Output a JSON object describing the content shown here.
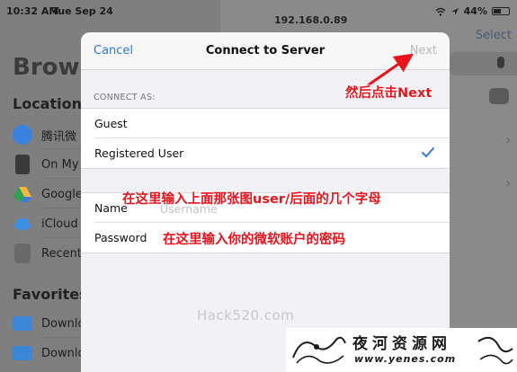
{
  "status_bar": {
    "time": "10:32 AM",
    "date": "Tue Sep 24",
    "battery": "44%"
  },
  "background": {
    "browse_title": "Brows",
    "locations_title": "Locations",
    "favorites_title": "Favorites",
    "locations": [
      {
        "label": "腾讯微",
        "icon": "cloud-icon",
        "color": "#3b82e0"
      },
      {
        "label": "On My",
        "icon": "ipad-icon",
        "color": "#3a3a3a"
      },
      {
        "label": "Google",
        "icon": "google-drive-icon",
        "color": "#2ea44f"
      },
      {
        "label": "iCloud",
        "icon": "icloud-icon",
        "color": "#3a8fe6"
      },
      {
        "label": "Recent",
        "icon": "trash-icon",
        "color": "#6a6a6a"
      }
    ],
    "favorites": [
      {
        "label": "Downlo",
        "icon": "folder-download-icon",
        "color": "#3c86d8"
      },
      {
        "label": "Downlo",
        "icon": "folder-icon",
        "color": "#3c86d8"
      }
    ],
    "address": "192.168.0.89",
    "select_label": "Select"
  },
  "dialog": {
    "cancel_label": "Cancel",
    "title": "Connect to Server",
    "next_label": "Next",
    "connect_as_label": "CONNECT AS:",
    "options": [
      {
        "label": "Guest",
        "selected": false
      },
      {
        "label": "Registered User",
        "selected": true
      }
    ],
    "name_label": "Name",
    "name_placeholder": "Username",
    "password_label": "Password",
    "password_placeholder": ""
  },
  "annotations": {
    "next_hint": "然后点击Next",
    "user_hint": "在这里输入上面那张图user/后面的几个字母",
    "password_hint": "在这里输入你的微软账户的密码",
    "arrow_color": "#e8131b"
  },
  "watermark": {
    "text": "Hack520.com",
    "logo_main": "夜河资源网",
    "logo_sub": "www.yenes.com"
  },
  "colors": {
    "accent": "#2f7ad6",
    "annotation": "#e8131b",
    "disabled": "#b9b9be"
  }
}
